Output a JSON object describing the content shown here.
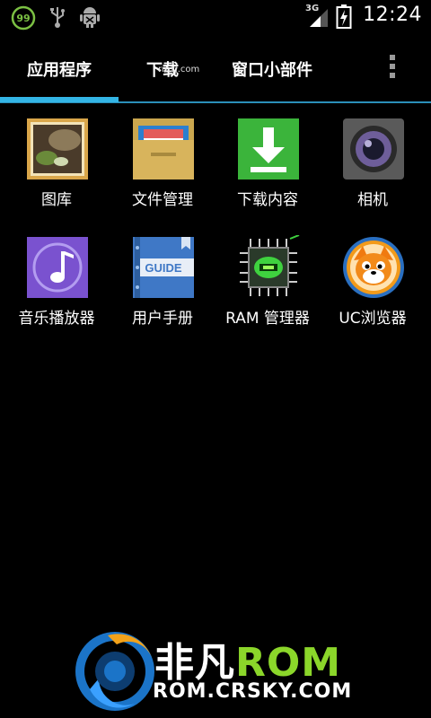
{
  "status_bar": {
    "battery_badge": "99",
    "network": "3G",
    "time": "12:24"
  },
  "tabs": [
    {
      "label": "应用程序"
    },
    {
      "label": "下载"
    },
    {
      "label": "窗口小部件"
    }
  ],
  "watermark": "rmzj.com",
  "apps": [
    {
      "label": "图库"
    },
    {
      "label": "文件管理"
    },
    {
      "label": "下载内容"
    },
    {
      "label": "相机"
    },
    {
      "label": "音乐播放器"
    },
    {
      "label": "用户手册"
    },
    {
      "label": "RAM 管理器"
    },
    {
      "label": "UC浏览器"
    }
  ],
  "user_manual_icon_text": "GUIDE",
  "logo": {
    "title_cn": "非凡",
    "title_rom": "ROM",
    "subtitle": "ROM.CRSKY.COM"
  },
  "colors": {
    "accent": "#33b5e5",
    "background": "#000000",
    "logo_green": "#8bd62a"
  }
}
